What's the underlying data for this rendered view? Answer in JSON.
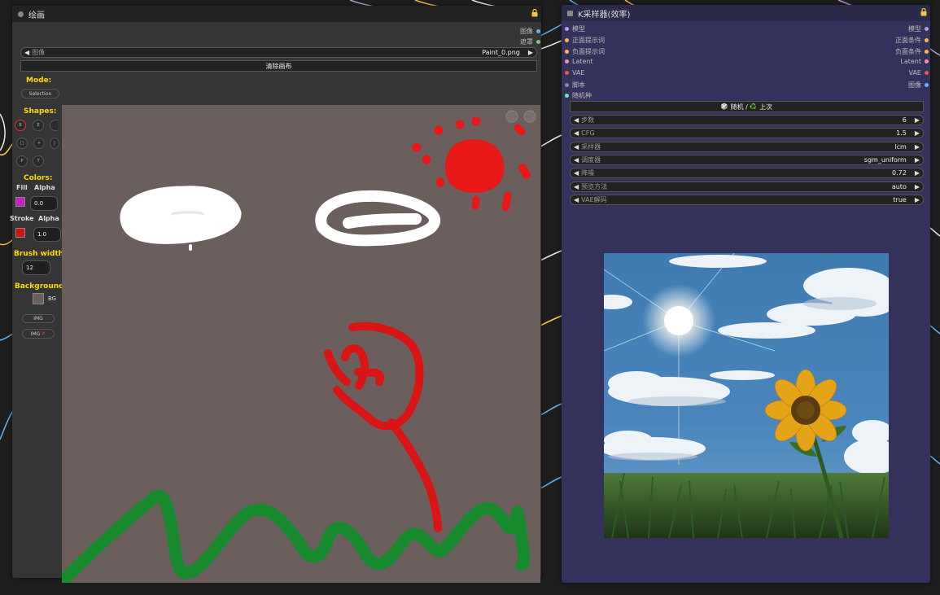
{
  "paint_node": {
    "title": "绘画",
    "outputs": [
      {
        "label": "图像",
        "color": "#64b5f6"
      },
      {
        "label": "遮罩",
        "color": "#81c784"
      }
    ],
    "image_widget": {
      "label": "图像",
      "value": "Paint_0.png"
    },
    "clear_button": "清除画布",
    "mode_label": "Mode:",
    "mode_value": "Selection",
    "shapes_label": "Shapes:",
    "shape_buttons": [
      "B",
      "E",
      "□",
      "+",
      "|",
      "P",
      "T"
    ],
    "colors_label": "Colors:",
    "fill_label": "Fill",
    "fill_alpha_label": "Alpha",
    "fill_alpha": "0.0",
    "fill_color": "#c81ec8",
    "stroke_label": "Stroke",
    "stroke_alpha_label": "Alpha",
    "stroke_alpha": "1.0",
    "stroke_color": "#d01212",
    "brush_label": "Brush width:",
    "brush_width": "12",
    "background_label": "Background:",
    "bg_label": "BG",
    "bg_color": "#6a5d5b",
    "img_button": "IMG",
    "img_x_button": "IMG",
    "img_x_glyph": "✕",
    "canvas_color": "#6b5f5d"
  },
  "ksampler_node": {
    "title": "K采样器(效率)",
    "inputs": [
      {
        "label": "模型",
        "color": "#b39ddb"
      },
      {
        "label": "正面提示词",
        "color": "#ffb74d"
      },
      {
        "label": "负面提示词",
        "color": "#ffb74d"
      },
      {
        "label": "Latent",
        "color": "#f48fb1"
      },
      {
        "label": "VAE",
        "color": "#ef5350"
      },
      {
        "label": "脚本",
        "color": "#7986cb"
      },
      {
        "label": "随机种",
        "color": "#69f0ae"
      }
    ],
    "outputs": [
      {
        "label": "模型",
        "color": "#b39ddb"
      },
      {
        "label": "正面条件",
        "color": "#ffb74d"
      },
      {
        "label": "负面条件",
        "color": "#ffb74d"
      },
      {
        "label": "Latent",
        "color": "#f48fb1"
      },
      {
        "label": "VAE",
        "color": "#ef5350"
      },
      {
        "label": "图像",
        "color": "#64b5f6"
      }
    ],
    "seed_button": {
      "icon": "🎲",
      "random": "随机",
      "sep": " / ",
      "recycle": "♻️",
      "last": "上次"
    },
    "widgets": [
      {
        "label": "步数",
        "value": "6"
      },
      {
        "label": "CFG",
        "value": "1.5"
      },
      {
        "label": "采样器",
        "value": "lcm"
      },
      {
        "label": "调度器",
        "value": "sgm_uniform"
      },
      {
        "label": "降噪",
        "value": "0.72"
      },
      {
        "label": "预览方法",
        "value": "auto"
      },
      {
        "label": "VAE解码",
        "value": "true"
      }
    ]
  },
  "colors": {
    "paint_body": "#353535",
    "paint_header": "#222222",
    "ks_body": "#34325a",
    "ks_header": "#2b2a4a",
    "lock": "#f4c542"
  }
}
